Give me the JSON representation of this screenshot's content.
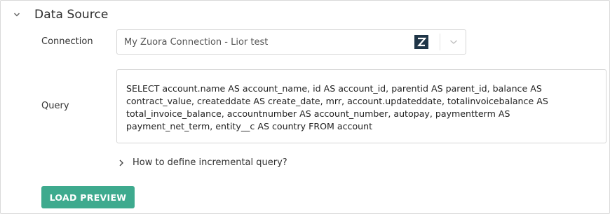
{
  "section": {
    "title": "Data Source"
  },
  "connection": {
    "label": "Connection",
    "selected": "My Zuora Connection - Lior test",
    "logo_letter": "Z",
    "logo_color": "#1f3547"
  },
  "query": {
    "label": "Query",
    "text": "SELECT account.name AS account_name, id AS account_id, parentid AS parent_id, balance AS contract_value, createddate AS create_date, mrr, account.updateddate, totalinvoicebalance AS total_invoice_balance, accountnumber AS account_number, autopay, paymentterm AS payment_net_term, entity__c AS country FROM account"
  },
  "help": {
    "label": "How to define incremental query?"
  },
  "actions": {
    "load_preview_label": "LOAD PREVIEW",
    "load_preview_color": "#3eaa8e"
  }
}
